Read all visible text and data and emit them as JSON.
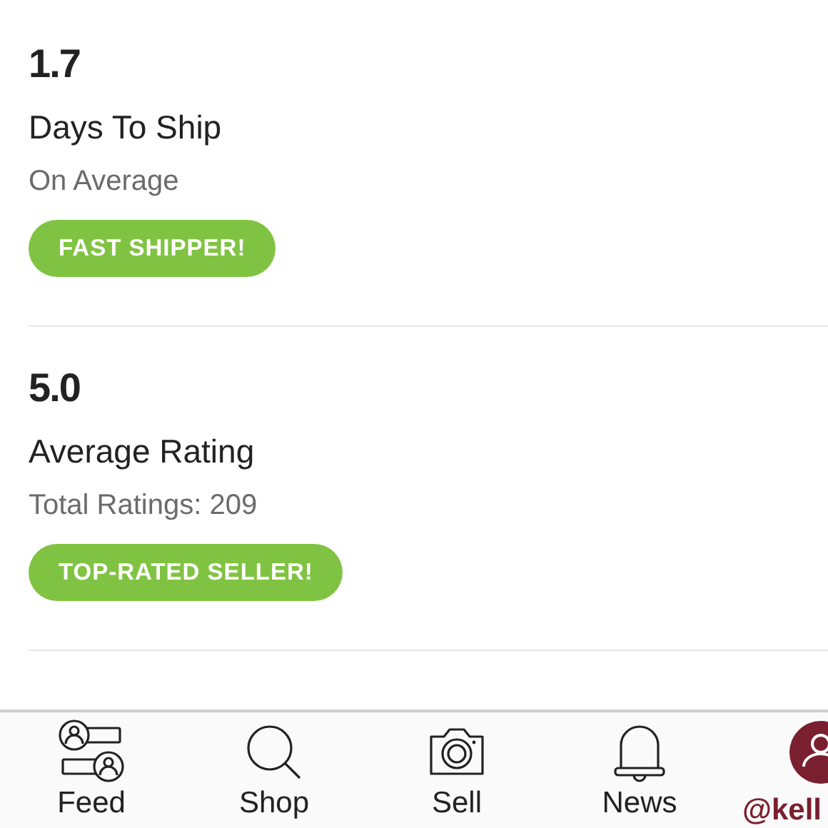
{
  "stats": [
    {
      "value": "1.7",
      "title": "Days To Ship",
      "subtitle": "On Average",
      "badge": "FAST SHIPPER!"
    },
    {
      "value": "5.0",
      "title": "Average Rating",
      "subtitle": "Total Ratings: 209",
      "badge": "TOP-RATED SELLER!"
    }
  ],
  "tab_bar": [
    {
      "kind": "feed",
      "label": "Feed",
      "selected": false
    },
    {
      "kind": "shop",
      "label": "Shop",
      "selected": false
    },
    {
      "kind": "sell",
      "label": "Sell",
      "selected": false
    },
    {
      "kind": "news",
      "label": "News",
      "selected": false
    },
    {
      "kind": "profile",
      "label": "@kell",
      "selected": true
    }
  ]
}
